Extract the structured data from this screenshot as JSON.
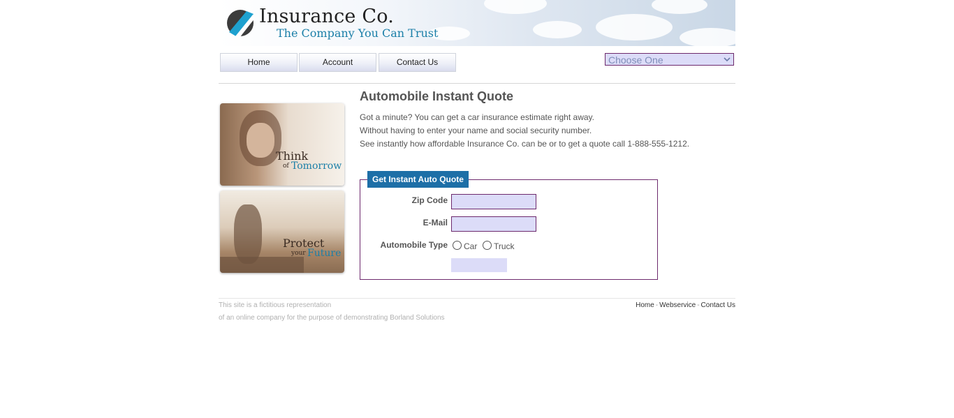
{
  "header": {
    "brand": "Insurance Co.",
    "tagline": "The Company You Can Trust"
  },
  "nav": {
    "items": [
      "Home",
      "Account",
      "Contact Us"
    ],
    "select_value": "Choose One"
  },
  "images": {
    "photo1": {
      "line1": "Think",
      "small": "of",
      "accent": "Tomorrow"
    },
    "photo2": {
      "line1": "Protect",
      "small": "your",
      "accent": "Future"
    }
  },
  "main": {
    "title": "Automobile Instant Quote",
    "paragraphs": [
      "Got a minute? You can get a car insurance estimate right away.",
      "Without having to enter your name and social security number.",
      "See instantly how affordable Insurance Co. can be or to get a quote call 1-888-555-1212."
    ]
  },
  "quote_form": {
    "legend": "Get Instant Auto Quote",
    "zip_label": "Zip Code",
    "email_label": "E-Mail",
    "type_label": "Automobile Type",
    "options": [
      "Car",
      "Truck"
    ]
  },
  "footer": {
    "left_line1": "This site is a fictitious representation",
    "left_line2": "of an online company for the purpose of demonstrating Borland Solutions",
    "links": [
      "Home",
      "Webservice",
      "Contact Us"
    ]
  },
  "colors": {
    "accent_blue": "#1d6fa7",
    "input_fill": "#dcdcf8",
    "input_border": "#6d2a6d"
  }
}
